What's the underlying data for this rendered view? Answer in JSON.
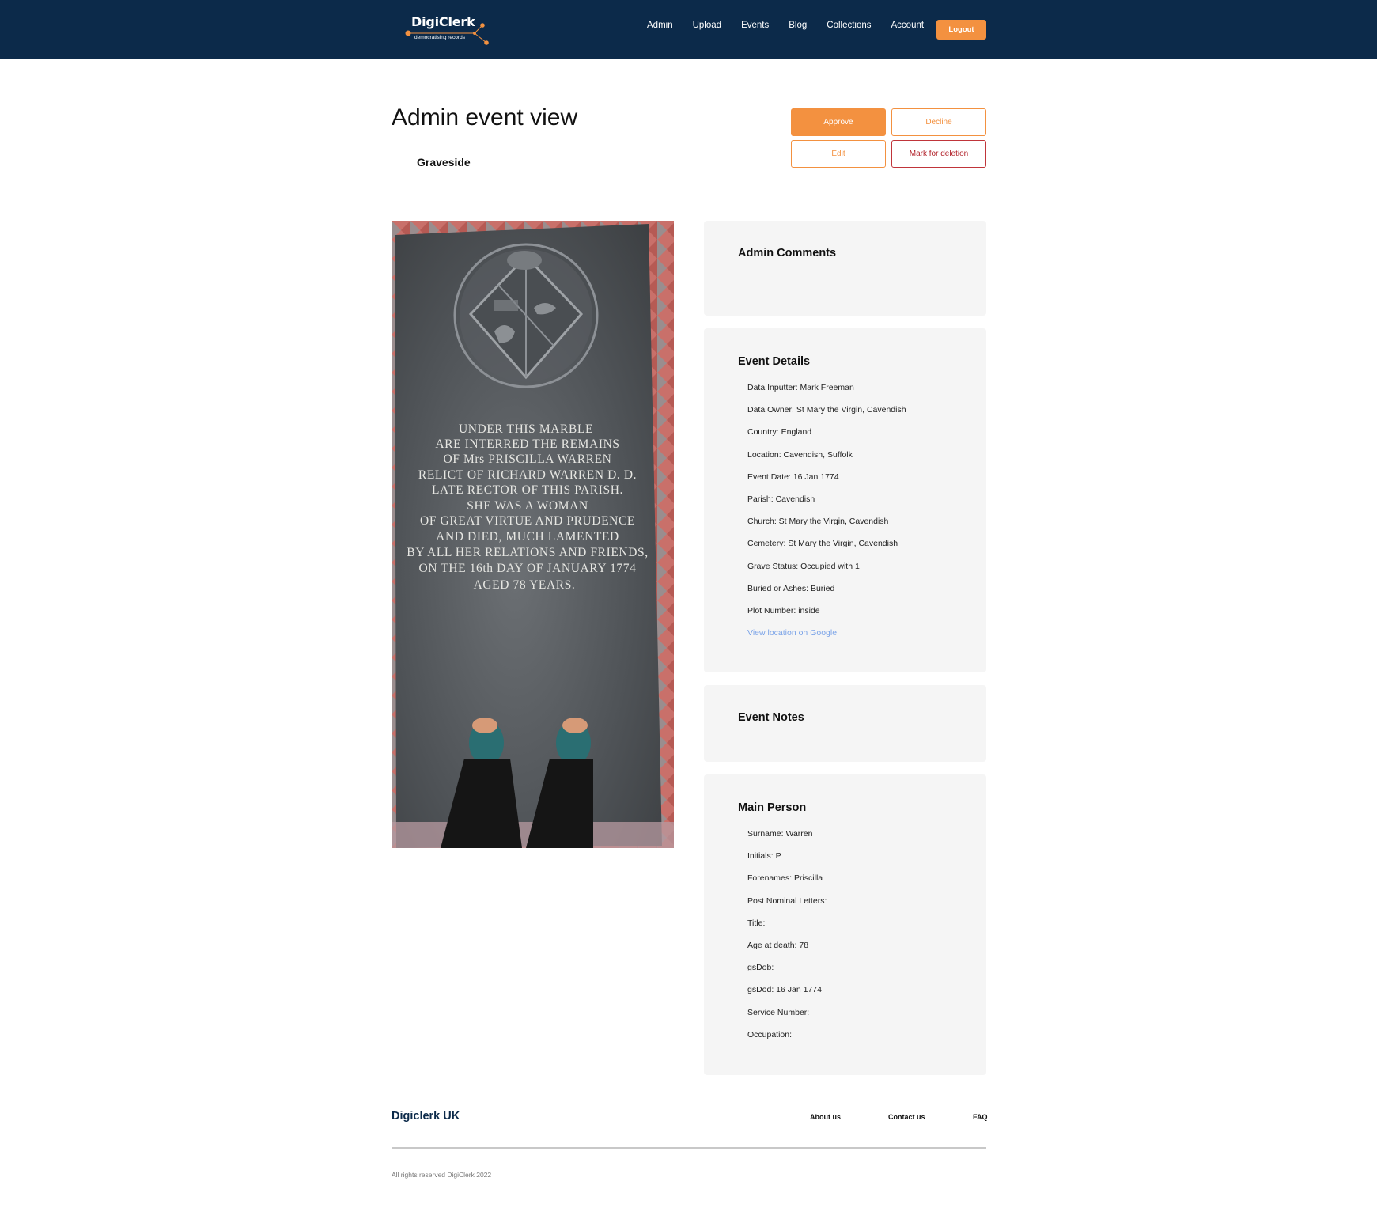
{
  "header": {
    "logo_title": "DigiClerk",
    "logo_subtitle": "democratising records",
    "nav": [
      "Admin",
      "Upload",
      "Events",
      "Blog",
      "Collections",
      "Account"
    ],
    "logout_label": "Logout"
  },
  "page": {
    "title": "Admin event view",
    "subtitle": "Graveside"
  },
  "actions": {
    "approve": "Approve",
    "decline": "Decline",
    "edit": "Edit",
    "mark_for_deletion": "Mark for deletion"
  },
  "photo": {
    "inscription": [
      "UNDER THIS MARBLE",
      "ARE INTERRED THE REMAINS",
      "OF Mrs PRISCILLA WARREN",
      "RELICT OF RICHARD WARREN D. D.",
      "LATE RECTOR OF THIS PARISH.",
      "SHE WAS A WOMAN",
      "OF GREAT VIRTUE AND PRUDENCE",
      "AND DIED, MUCH LAMENTED",
      "BY ALL HER RELATIONS AND FRIENDS,",
      "ON THE 16th DAY OF JANUARY 1774",
      "AGED 78 YEARS."
    ]
  },
  "admin_comments": {
    "title": "Admin Comments"
  },
  "event_details": {
    "title": "Event Details",
    "items": [
      "Data Inputter: Mark Freeman",
      "Data Owner: St Mary the Virgin, Cavendish",
      "Country: England",
      "Location: Cavendish, Suffolk",
      "Event Date: 16 Jan 1774",
      "Parish: Cavendish",
      "Church: St Mary the Virgin, Cavendish",
      "Cemetery: St Mary the Virgin, Cavendish",
      "Grave Status: Occupied with 1",
      "Buried or Ashes: Buried",
      "Plot Number: inside"
    ],
    "map_link": "View location on Google"
  },
  "event_notes": {
    "title": "Event Notes"
  },
  "main_person": {
    "title": "Main Person",
    "items": [
      "Surname: Warren",
      "Initials: P",
      "Forenames: Priscilla",
      "Post Nominal Letters:",
      "Title:",
      "Age at death: 78",
      "gsDob:",
      "gsDod: 16 Jan 1774",
      "Service Number:",
      "Occupation:"
    ]
  },
  "footer": {
    "brand": "Digiclerk UK",
    "links": [
      "About us",
      "Contact us",
      "FAQ"
    ],
    "copyright": "All rights reserved DigiClerk 2022"
  },
  "colors": {
    "header_bg": "#0c2a4a",
    "accent": "#f39140",
    "danger": "#b1222a",
    "card_bg": "#f5f5f5",
    "link": "#7aa3e8"
  }
}
